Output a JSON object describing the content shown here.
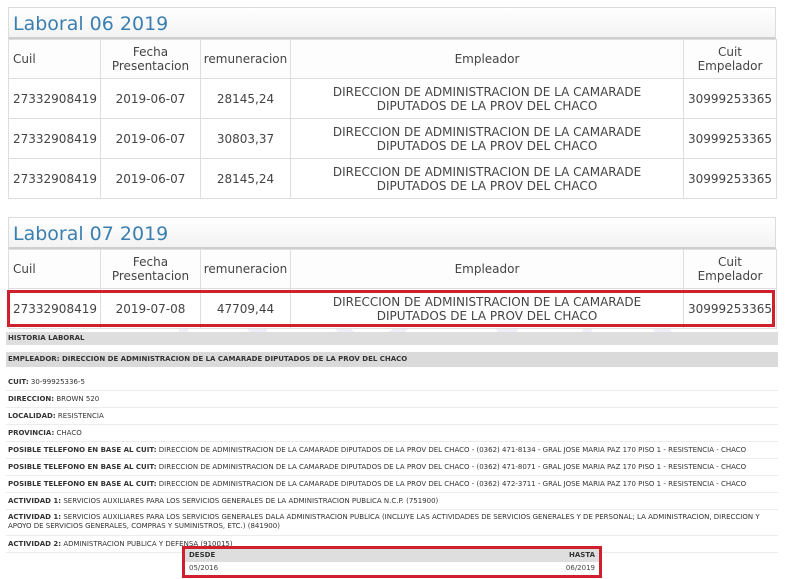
{
  "watermark": "NOVA",
  "columns": {
    "cuil": "Cuil",
    "fecha_l1": "Fecha",
    "fecha_l2": "Presentacion",
    "remuneracion": "remuneracion",
    "empleador": "Empleador",
    "cuit_l1": "Cuit",
    "cuit_l2": "Empelador"
  },
  "panels": [
    {
      "title": "Laboral 06 2019",
      "rows": [
        {
          "cuil": "27332908419",
          "fecha": "2019-06-07",
          "remuneracion": "28145,24",
          "empleador_l1": "DIRECCION DE ADMINISTRACION DE LA CAMARADE",
          "empleador_l2": "DIPUTADOS DE LA PROV DEL CHACO",
          "cuit": "30999253365"
        },
        {
          "cuil": "27332908419",
          "fecha": "2019-06-07",
          "remuneracion": "30803,37",
          "empleador_l1": "DIRECCION DE ADMINISTRACION DE LA CAMARADE",
          "empleador_l2": "DIPUTADOS DE LA PROV DEL CHACO",
          "cuit": "30999253365"
        },
        {
          "cuil": "27332908419",
          "fecha": "2019-06-07",
          "remuneracion": "28145,24",
          "empleador_l1": "DIRECCION DE ADMINISTRACION DE LA CAMARADE",
          "empleador_l2": "DIPUTADOS DE LA PROV DEL CHACO",
          "cuit": "30999253365"
        }
      ]
    },
    {
      "title": "Laboral 07 2019",
      "rows": [
        {
          "cuil": "27332908419",
          "fecha": "2019-07-08",
          "remuneracion": "47709,44",
          "empleador_l1": "DIRECCION DE ADMINISTRACION DE LA CAMARADE",
          "empleador_l2": "DIPUTADOS DE LA PROV DEL CHACO",
          "cuit": "30999253365"
        }
      ]
    }
  ],
  "historia": {
    "header": "HISTORIA LABORAL",
    "empleador_label": "EMPLEADOR:",
    "empleador_value": "DIRECCION DE ADMINISTRACION DE LA CAMARADE DIPUTADOS DE LA PROV DEL CHACO",
    "fields": [
      {
        "label": "CUIT:",
        "value": "30-99925336-5"
      },
      {
        "label": "DIRECCION:",
        "value": "BROWN 520"
      },
      {
        "label": "LOCALIDAD:",
        "value": "RESISTENCIA"
      },
      {
        "label": "PROVINCIA:",
        "value": "CHACO"
      },
      {
        "label": "POSIBLE TELEFONO EN BASE AL CUIT:",
        "value": "DIRECCION DE ADMINISTRACION DE LA CAMARADE DIPUTADOS DE LA PROV DEL CHACO - (0362) 471-8134 - GRAL JOSE MARIA PAZ 170 PISO 1 - RESISTENCIA - CHACO"
      },
      {
        "label": "POSIBLE TELEFONO EN BASE AL CUIT:",
        "value": "DIRECCION DE ADMINISTRACION DE LA CAMARADE DIPUTADOS DE LA PROV DEL CHACO - (0362) 471-8071 - GRAL JOSE MARIA PAZ 170 PISO 1 - RESISTENCIA - CHACO"
      },
      {
        "label": "POSIBLE TELEFONO EN BASE AL CUIT:",
        "value": "DIRECCION DE ADMINISTRACION DE LA CAMARADE DIPUTADOS DE LA PROV DEL CHACO - (0362) 472-3711 - GRAL JOSE MARIA PAZ 170 PISO 1 - RESISTENCIA - CHACO"
      },
      {
        "label": "ACTIVIDAD 1:",
        "value": "SERVICIOS AUXILIARES PARA LOS SERVICIOS GENERALES DE LA ADMINISTRACION PUBLICA N.C.P. (751900)"
      },
      {
        "label": "ACTIVIDAD 1:",
        "value": "SERVICIOS AUXILIARES PARA LOS SERVICIOS GENERALES DALA ADMINISTRACION PUBLICA (INCLUYE LAS ACTIVIDADES DE SERVICIOS GENERALES Y DE PERSONAL; LA ADMINISTRACION, DIRECCION Y APOYO DE SERVICIOS GENERALES, COMPRAS Y SUMINISTROS, ETC.) (841900)"
      },
      {
        "label": "ACTIVIDAD 2:",
        "value": "ADMINISTRACION PUBLICA Y DEFENSA (910015)"
      }
    ],
    "desde_label": "DESDE",
    "hasta_label": "HASTA",
    "desde_value": "05/2016",
    "hasta_value": "06/2019"
  }
}
